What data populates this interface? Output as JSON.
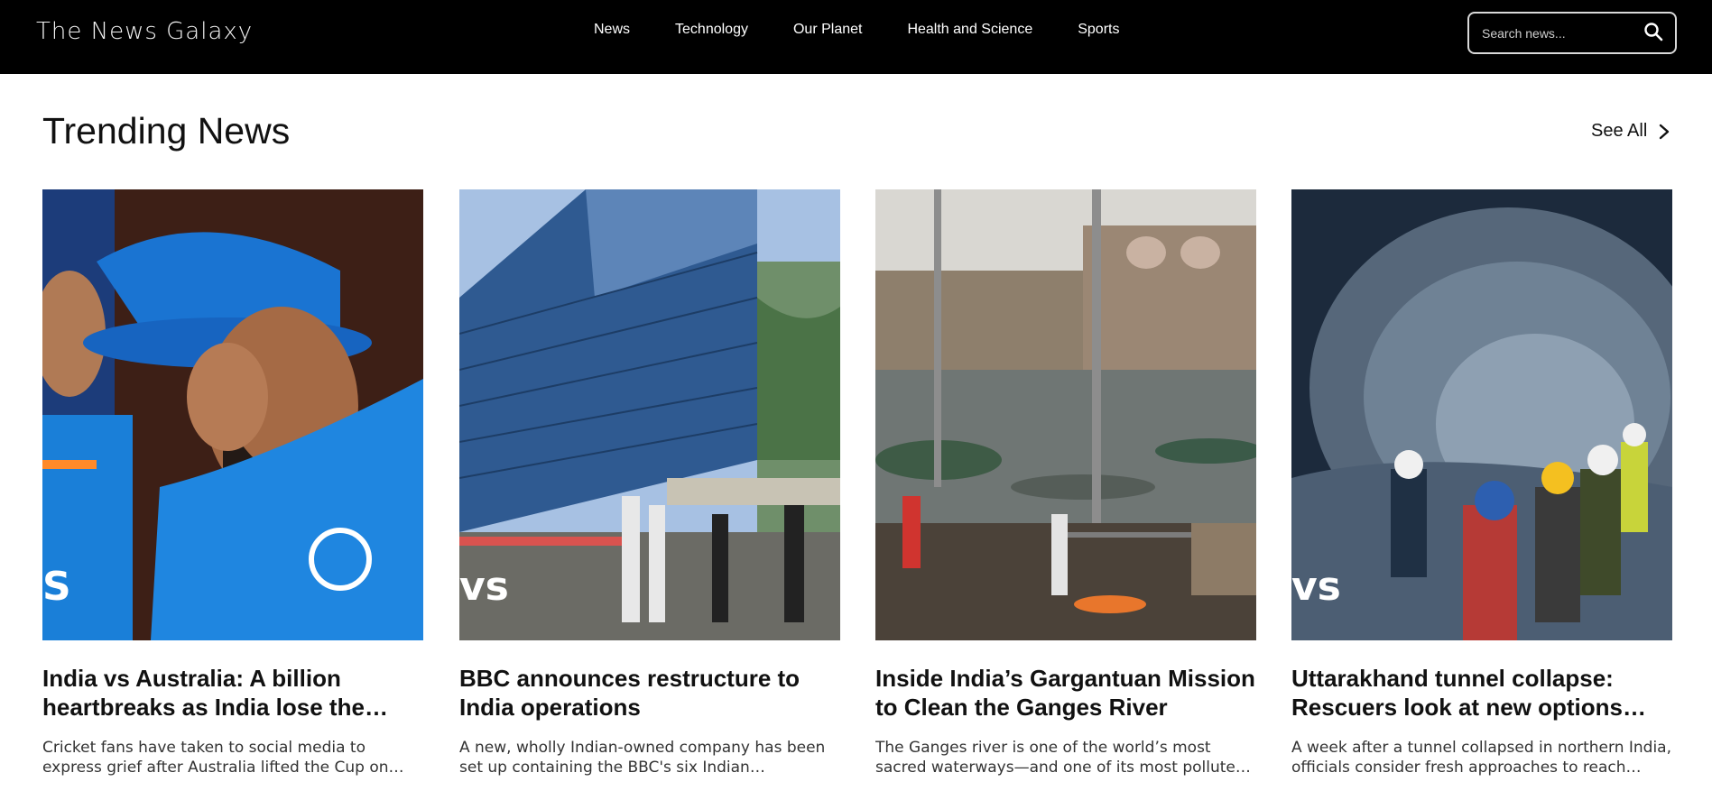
{
  "header": {
    "brand": "The News Galaxy",
    "nav": [
      "News",
      "Technology",
      "Our Planet",
      "Health and Science",
      "Sports"
    ],
    "search_placeholder": "Search news...",
    "icons": {
      "search": "search-icon"
    }
  },
  "section": {
    "title": "Trending News",
    "see_all": "See All",
    "icons": {
      "see_all": "chevron-right-icon"
    }
  },
  "cards": [
    {
      "title": "India vs Australia: A billion heartbreaks as India lose the ICC…",
      "desc": "Cricket fans have taken to social media to express grief after Australia lifted the Cup on Sunday.",
      "image": "cricket-player-photo",
      "watermark": "S"
    },
    {
      "title": "BBC announces restructure to India operations",
      "desc": "A new, wholly Indian-owned company has been set up containing the BBC's six Indian language…",
      "image": "office-building-photo",
      "watermark": "vs"
    },
    {
      "title": "Inside India’s Gargantuan Mission to Clean the Ganges River",
      "desc": "The Ganges river is one of the world’s most sacred waterways—and one of its most polluted. To restor…",
      "image": "ganges-river-ghat-photo",
      "watermark": ""
    },
    {
      "title": "Uttarakhand tunnel collapse: Rescuers look at new options to…",
      "desc": "A week after a tunnel collapsed in northern India, officials consider fresh approaches to reach…",
      "image": "tunnel-rescue-photo",
      "watermark": "vs"
    }
  ],
  "colors": {
    "header_bg": "#000000",
    "text": "#111111"
  }
}
